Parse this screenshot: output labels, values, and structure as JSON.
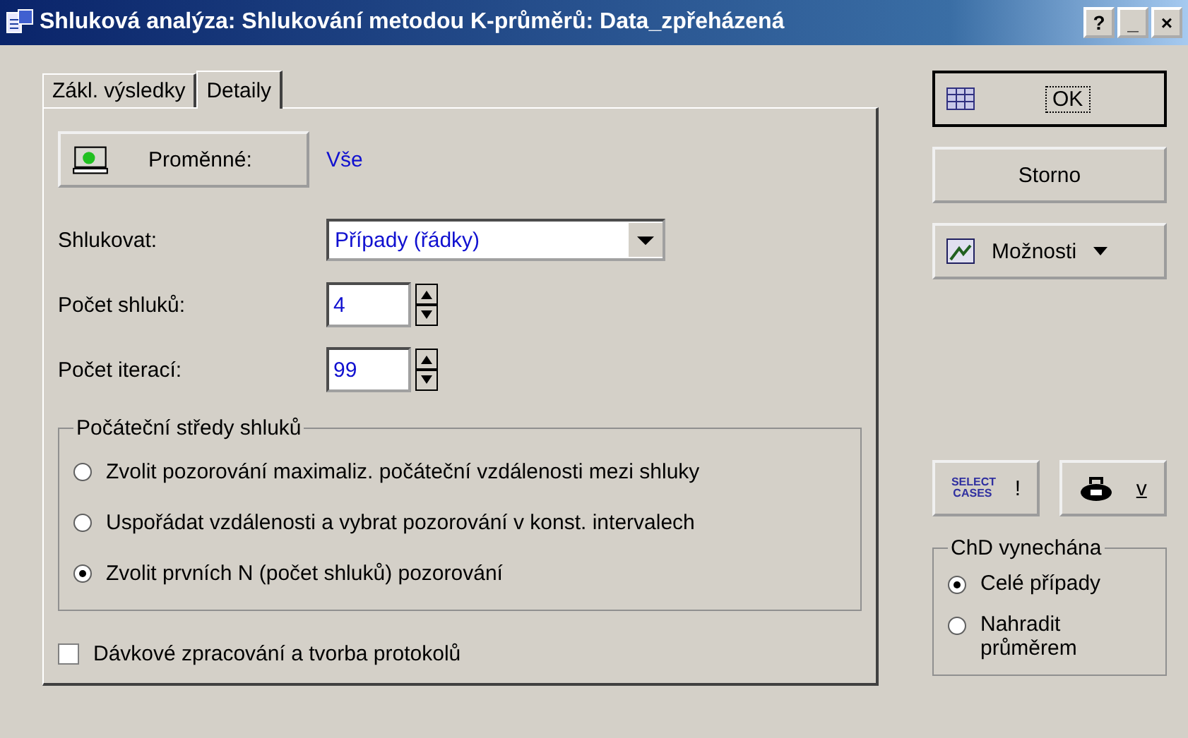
{
  "window": {
    "title": "Shluková analýza: Shlukování metodou K-průměrů: Data_zpřeházená",
    "controls": [
      "?",
      "_",
      "×"
    ]
  },
  "tabs": [
    {
      "label": "Zákl. výsledky",
      "selected": false
    },
    {
      "label": "Detaily",
      "selected": true
    }
  ],
  "variables": {
    "button": "Proměnné:",
    "value": "Vše"
  },
  "cluster_by": {
    "label": "Shlukovat:",
    "value": "Případy (řádky)"
  },
  "spinners": [
    {
      "label": "Počet shluků:",
      "value": "4"
    },
    {
      "label": "Počet iterací:",
      "value": "99"
    }
  ],
  "initial_centers": {
    "title": "Počáteční středy shluků",
    "options": [
      {
        "label": "Zvolit pozorování maximaliz. počáteční vzdálenosti mezi shluky",
        "selected": false
      },
      {
        "label": "Uspořádat vzdálenosti a vybrat pozorování v konst. intervalech",
        "selected": false
      },
      {
        "label": "Zvolit prvních N (počet shluků) pozorování",
        "selected": true
      }
    ]
  },
  "batch": {
    "label": "Dávkové zpracování a tvorba protokolů",
    "checked": false
  },
  "buttons": {
    "ok": "OK",
    "cancel": "Storno",
    "options": "Možnosti"
  },
  "select_cases": {
    "icon_text": "SELECT CASES",
    "label": "!"
  },
  "weight_button": {
    "label": "v"
  },
  "missing_data": {
    "title": "ChD vynechána",
    "options": [
      {
        "label": "Celé případy",
        "selected": true
      },
      {
        "label": "Nahradit průměrem",
        "selected": false
      }
    ]
  }
}
